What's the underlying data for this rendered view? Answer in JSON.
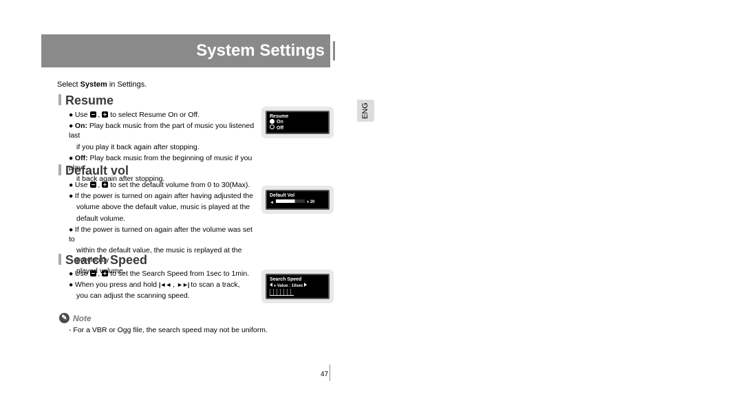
{
  "banner_title": "System Settings",
  "intro_prefix": "Select ",
  "intro_bold": "System",
  "intro_suffix": " in Settings.",
  "lang": "ENG",
  "sections": {
    "resume": {
      "title": "Resume",
      "l1a": "Use ",
      "l1b": " , ",
      "l1c": " to select Resume On or Off.",
      "l2label": "On:",
      "l2": " Play back music from the part of music you listened last",
      "l2b": "if you play it back again after stopping.",
      "l3label": "Off:",
      "l3": " Play back music from the beginning of music if you play",
      "l3b": "it back again after stopping.",
      "screen": {
        "title": "Resume",
        "on": "On",
        "off": "Off"
      }
    },
    "defaultvol": {
      "title": "Default vol",
      "l1a": "Use ",
      "l1b": " , ",
      "l1c": " to set the default volume from 0 to 30(Max).",
      "l2": "If the power is turned on again after having adjusted the",
      "l2b": "volume above the default value, music is played at the",
      "l2c": "default volume.",
      "l3": "If the power is turned on again after the volume was set to",
      "l3b": "within the default value, the music is replayed at the previously",
      "l3c": "played volume.",
      "screen": {
        "title": "Default Vol",
        "arrow": "◄",
        "value": "20"
      }
    },
    "searchspeed": {
      "title": "Search Speed",
      "l1a": "Use ",
      "l1b": " , ",
      "l1c": " to set the Search Speed from 1sec to 1min.",
      "l2a": "When you press and hold ",
      "l2b": " , ",
      "l2c": "  to scan a track,",
      "l2d": "you can  adjust the scanning speed.",
      "screen": {
        "title": "Search Speed",
        "value": "Value : 10sec"
      }
    }
  },
  "note": {
    "label": "Note",
    "text": "- For a VBR or Ogg file, the search speed may not be uniform."
  },
  "page_number": "47"
}
